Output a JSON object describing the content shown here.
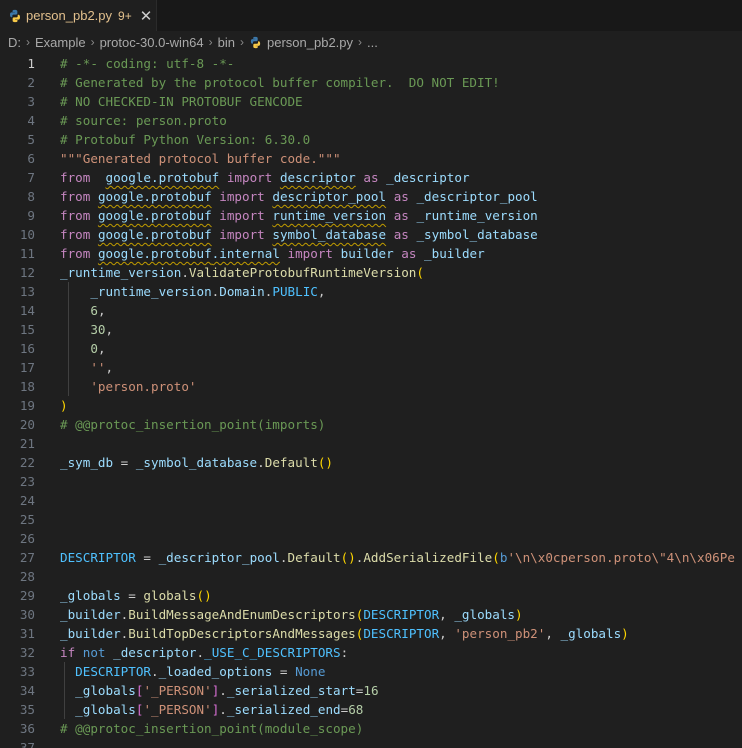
{
  "tab": {
    "filename": "person_pb2.py",
    "problems": "9+",
    "close_glyph": "✕"
  },
  "breadcrumb": {
    "items": [
      "D:",
      "Example",
      "protoc-30.0-win64",
      "bin",
      "person_pb2.py",
      "..."
    ],
    "separator": "›"
  },
  "colors": {
    "background": "#1f1f1f",
    "comment": "#6a9955",
    "keyword": "#c586c0",
    "string": "#ce9178",
    "function": "#dcdcaa",
    "variable": "#9cdcfe",
    "constant": "#4fc1ff",
    "number": "#b5cea8",
    "modified_tab": "#e2c08d"
  },
  "editor": {
    "lines": [
      {
        "n": "1",
        "active": true,
        "tokens": [
          [
            "cm",
            "# -*- coding: utf-8 -*-"
          ]
        ]
      },
      {
        "n": "2",
        "tokens": [
          [
            "cm",
            "# Generated by the protocol buffer compiler.  DO NOT EDIT!"
          ]
        ]
      },
      {
        "n": "3",
        "tokens": [
          [
            "cm",
            "# NO CHECKED-IN PROTOBUF GENCODE"
          ]
        ]
      },
      {
        "n": "4",
        "tokens": [
          [
            "cm",
            "# source: person.proto"
          ]
        ]
      },
      {
        "n": "5",
        "tokens": [
          [
            "cm",
            "# Protobuf Python Version: 6.30.0"
          ]
        ]
      },
      {
        "n": "6",
        "tokens": [
          [
            "st",
            "\"\"\"Generated protocol buffer code.\"\"\""
          ]
        ]
      },
      {
        "n": "7",
        "tokens": [
          [
            "kw",
            "from"
          ],
          [
            "",
            "  "
          ],
          [
            "var sq",
            "google.protobuf"
          ],
          [
            "",
            " "
          ],
          [
            "kw",
            "import"
          ],
          [
            "",
            " "
          ],
          [
            "var sq",
            "descriptor"
          ],
          [
            "",
            " "
          ],
          [
            "kw",
            "as"
          ],
          [
            "",
            " "
          ],
          [
            "var",
            "_descriptor"
          ]
        ]
      },
      {
        "n": "8",
        "tokens": [
          [
            "kw",
            "from"
          ],
          [
            "",
            " "
          ],
          [
            "var sq",
            "google.protobuf"
          ],
          [
            "",
            " "
          ],
          [
            "kw",
            "import"
          ],
          [
            "",
            " "
          ],
          [
            "var sq",
            "descriptor_pool"
          ],
          [
            "",
            " "
          ],
          [
            "kw",
            "as"
          ],
          [
            "",
            " "
          ],
          [
            "var",
            "_descriptor_pool"
          ]
        ]
      },
      {
        "n": "9",
        "tokens": [
          [
            "kw",
            "from"
          ],
          [
            "",
            " "
          ],
          [
            "var sq",
            "google.protobuf"
          ],
          [
            "",
            " "
          ],
          [
            "kw",
            "import"
          ],
          [
            "",
            " "
          ],
          [
            "var sq",
            "runtime_version"
          ],
          [
            "",
            " "
          ],
          [
            "kw",
            "as"
          ],
          [
            "",
            " "
          ],
          [
            "var",
            "_runtime_version"
          ]
        ]
      },
      {
        "n": "10",
        "tokens": [
          [
            "kw",
            "from"
          ],
          [
            "",
            " "
          ],
          [
            "var sq",
            "google.protobuf"
          ],
          [
            "",
            " "
          ],
          [
            "kw",
            "import"
          ],
          [
            "",
            " "
          ],
          [
            "var sq",
            "symbol_database"
          ],
          [
            "",
            " "
          ],
          [
            "kw",
            "as"
          ],
          [
            "",
            " "
          ],
          [
            "var",
            "_symbol_database"
          ]
        ]
      },
      {
        "n": "11",
        "tokens": [
          [
            "kw",
            "from"
          ],
          [
            "",
            " "
          ],
          [
            "var sq",
            "google.protobuf"
          ],
          [
            "var sq",
            ".internal"
          ],
          [
            "",
            " "
          ],
          [
            "kw",
            "import"
          ],
          [
            "",
            " "
          ],
          [
            "var",
            "builder"
          ],
          [
            "",
            " "
          ],
          [
            "kw",
            "as"
          ],
          [
            "",
            " "
          ],
          [
            "var",
            "_builder"
          ]
        ]
      },
      {
        "n": "12",
        "tokens": [
          [
            "var",
            "_runtime_version"
          ],
          [
            "",
            "."
          ],
          [
            "fn",
            "ValidateProtobufRuntimeVersion"
          ],
          [
            "br",
            "("
          ]
        ]
      },
      {
        "n": "13",
        "guide": true,
        "tokens": [
          [
            "",
            "    "
          ],
          [
            "var",
            "_runtime_version"
          ],
          [
            "",
            "."
          ],
          [
            "var",
            "Domain"
          ],
          [
            "",
            "."
          ],
          [
            "cst",
            "PUBLIC"
          ],
          [
            "",
            ","
          ]
        ]
      },
      {
        "n": "14",
        "guide": true,
        "tokens": [
          [
            "",
            "    "
          ],
          [
            "num",
            "6"
          ],
          [
            "",
            ","
          ]
        ]
      },
      {
        "n": "15",
        "guide": true,
        "tokens": [
          [
            "",
            "    "
          ],
          [
            "num",
            "30"
          ],
          [
            "",
            ","
          ]
        ]
      },
      {
        "n": "16",
        "guide": true,
        "tokens": [
          [
            "",
            "    "
          ],
          [
            "num",
            "0"
          ],
          [
            "",
            ","
          ]
        ]
      },
      {
        "n": "17",
        "guide": true,
        "tokens": [
          [
            "",
            "    "
          ],
          [
            "st",
            "''"
          ],
          [
            "",
            ","
          ]
        ]
      },
      {
        "n": "18",
        "guide": true,
        "tokens": [
          [
            "",
            "    "
          ],
          [
            "st",
            "'person.proto'"
          ]
        ]
      },
      {
        "n": "19",
        "tokens": [
          [
            "br",
            ")"
          ]
        ]
      },
      {
        "n": "20",
        "tokens": [
          [
            "cm",
            "# @@protoc_insertion_point(imports)"
          ]
        ]
      },
      {
        "n": "21",
        "tokens": []
      },
      {
        "n": "22",
        "tokens": [
          [
            "var",
            "_sym_db"
          ],
          [
            "",
            " = "
          ],
          [
            "var",
            "_symbol_database"
          ],
          [
            "",
            "."
          ],
          [
            "fn",
            "Default"
          ],
          [
            "br",
            "()"
          ]
        ]
      },
      {
        "n": "23",
        "tokens": []
      },
      {
        "n": "24",
        "tokens": []
      },
      {
        "n": "25",
        "tokens": []
      },
      {
        "n": "26",
        "tokens": []
      },
      {
        "n": "27",
        "tokens": [
          [
            "cst",
            "DESCRIPTOR"
          ],
          [
            "",
            " = "
          ],
          [
            "var",
            "_descriptor_pool"
          ],
          [
            "",
            "."
          ],
          [
            "fn",
            "Default"
          ],
          [
            "br",
            "()"
          ],
          [
            "",
            "."
          ],
          [
            "fn",
            "AddSerializedFile"
          ],
          [
            "br",
            "("
          ],
          [
            "kwblue",
            "b"
          ],
          [
            "st",
            "'\\n\\x0cperson.proto\\\"4\\n\\x06Pe"
          ]
        ]
      },
      {
        "n": "28",
        "tokens": []
      },
      {
        "n": "29",
        "tokens": [
          [
            "var",
            "_globals"
          ],
          [
            "",
            " = "
          ],
          [
            "fn",
            "globals"
          ],
          [
            "br",
            "()"
          ]
        ]
      },
      {
        "n": "30",
        "tokens": [
          [
            "var",
            "_builder"
          ],
          [
            "",
            "."
          ],
          [
            "fn",
            "BuildMessageAndEnumDescriptors"
          ],
          [
            "br",
            "("
          ],
          [
            "cst",
            "DESCRIPTOR"
          ],
          [
            "",
            ", "
          ],
          [
            "var",
            "_globals"
          ],
          [
            "br",
            ")"
          ]
        ]
      },
      {
        "n": "31",
        "tokens": [
          [
            "var",
            "_builder"
          ],
          [
            "",
            "."
          ],
          [
            "fn",
            "BuildTopDescriptorsAndMessages"
          ],
          [
            "br",
            "("
          ],
          [
            "cst",
            "DESCRIPTOR"
          ],
          [
            "",
            ", "
          ],
          [
            "st",
            "'person_pb2'"
          ],
          [
            "",
            ", "
          ],
          [
            "var",
            "_globals"
          ],
          [
            "br",
            ")"
          ]
        ]
      },
      {
        "n": "32",
        "tokens": [
          [
            "kw",
            "if"
          ],
          [
            "",
            " "
          ],
          [
            "kwblue",
            "not"
          ],
          [
            "",
            " "
          ],
          [
            "var",
            "_descriptor"
          ],
          [
            "",
            "."
          ],
          [
            "cst",
            "_USE_C_DESCRIPTORS"
          ],
          [
            "",
            ":"
          ]
        ]
      },
      {
        "n": "33",
        "guide2": true,
        "tokens": [
          [
            "",
            "  "
          ],
          [
            "cst",
            "DESCRIPTOR"
          ],
          [
            "",
            "."
          ],
          [
            "var",
            "_loaded_options"
          ],
          [
            "",
            " = "
          ],
          [
            "kwblue",
            "None"
          ]
        ]
      },
      {
        "n": "34",
        "guide2": true,
        "tokens": [
          [
            "",
            "  "
          ],
          [
            "var",
            "_globals"
          ],
          [
            "br2",
            "["
          ],
          [
            "st",
            "'_PERSON'"
          ],
          [
            "br2",
            "]"
          ],
          [
            "",
            "."
          ],
          [
            "var",
            "_serialized_start"
          ],
          [
            "",
            "="
          ],
          [
            "num",
            "16"
          ]
        ]
      },
      {
        "n": "35",
        "guide2": true,
        "tokens": [
          [
            "",
            "  "
          ],
          [
            "var",
            "_globals"
          ],
          [
            "br2",
            "["
          ],
          [
            "st",
            "'_PERSON'"
          ],
          [
            "br2",
            "]"
          ],
          [
            "",
            "."
          ],
          [
            "var",
            "_serialized_end"
          ],
          [
            "",
            "="
          ],
          [
            "num",
            "68"
          ]
        ]
      },
      {
        "n": "36",
        "tokens": [
          [
            "cm",
            "# @@protoc_insertion_point(module_scope)"
          ]
        ]
      },
      {
        "n": "37",
        "tokens": []
      }
    ]
  }
}
